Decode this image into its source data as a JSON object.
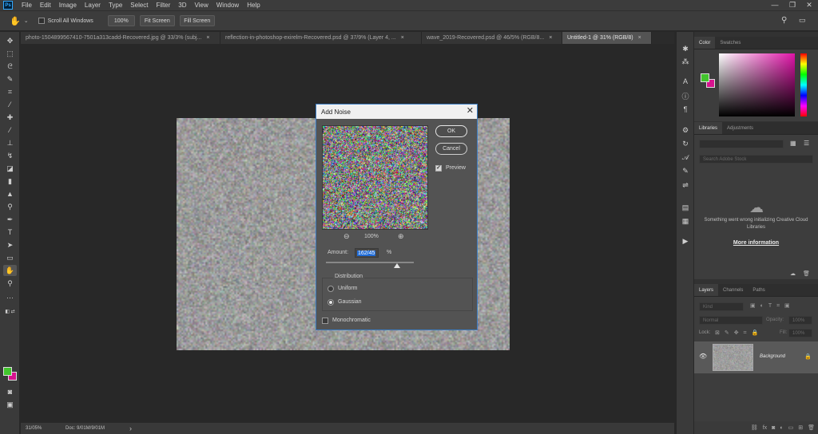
{
  "menu": [
    "File",
    "Edit",
    "Image",
    "Layer",
    "Type",
    "Select",
    "Filter",
    "3D",
    "View",
    "Window",
    "Help"
  ],
  "window_controls": {
    "minimize": "—",
    "restore": "❐",
    "close": "✕"
  },
  "options": {
    "scroll_all_windows": "Scroll All Windows",
    "zoom_100": "100%",
    "fit_screen": "Fit Screen",
    "fill_screen": "Fill Screen"
  },
  "tabs": [
    {
      "label": "photo-1504899567410-7501a313cadd-Recovered.jpg @ 33/3% (subj...",
      "active": false
    },
    {
      "label": "reflection-in-photoshop-exirelm-Recovered.psd @ 37/9% (Layer 4, ...",
      "active": false
    },
    {
      "label": "wave_2019-Recovered.psd @ 46/5% (RGB/8...",
      "active": false
    },
    {
      "label": "Untitled-1 @ 31% (RGB/8)",
      "active": true
    }
  ],
  "status": {
    "zoom": "31/05%",
    "doc": "Doc: 9/01M/9/01M",
    "arrow": "›"
  },
  "dialog": {
    "title": "Add Noise",
    "close": "✕",
    "ok": "OK",
    "cancel": "Cancel",
    "preview_label": "Preview",
    "preview_checked": true,
    "zoom_level": "100%",
    "amount_label": "Amount:",
    "amount_value": "162/45",
    "amount_unit": "%",
    "amount_slider": 0.81,
    "distribution_label": "Distribution",
    "uniform_label": "Uniform",
    "gaussian_label": "Gaussian",
    "selected_distribution": "Gaussian",
    "monochromatic_label": "Monochromatic",
    "monochromatic_checked": false
  },
  "colors": {
    "foreground": "#42c42d",
    "background": "#d6138e",
    "accent": "#3b7cc2"
  },
  "panels": {
    "color_tabs": [
      "Color",
      "Swatches"
    ],
    "libraries_tabs": [
      "Libraries",
      "Adjustments"
    ],
    "libraries_search_placeholder": "Search Adobe Stock",
    "libraries_message": "Something went wrong initializing Creative Cloud Libraries",
    "libraries_link": "More information",
    "layers_tabs": [
      "Layers",
      "Channels",
      "Paths"
    ],
    "kind_placeholder": "Kind",
    "blend_mode": "Normal",
    "opacity_label": "Opacity:",
    "opacity_value": "100%",
    "lock_label": "Lock:",
    "fill_label": "Fill:",
    "fill_value": "100%",
    "layer_name": "Background"
  }
}
